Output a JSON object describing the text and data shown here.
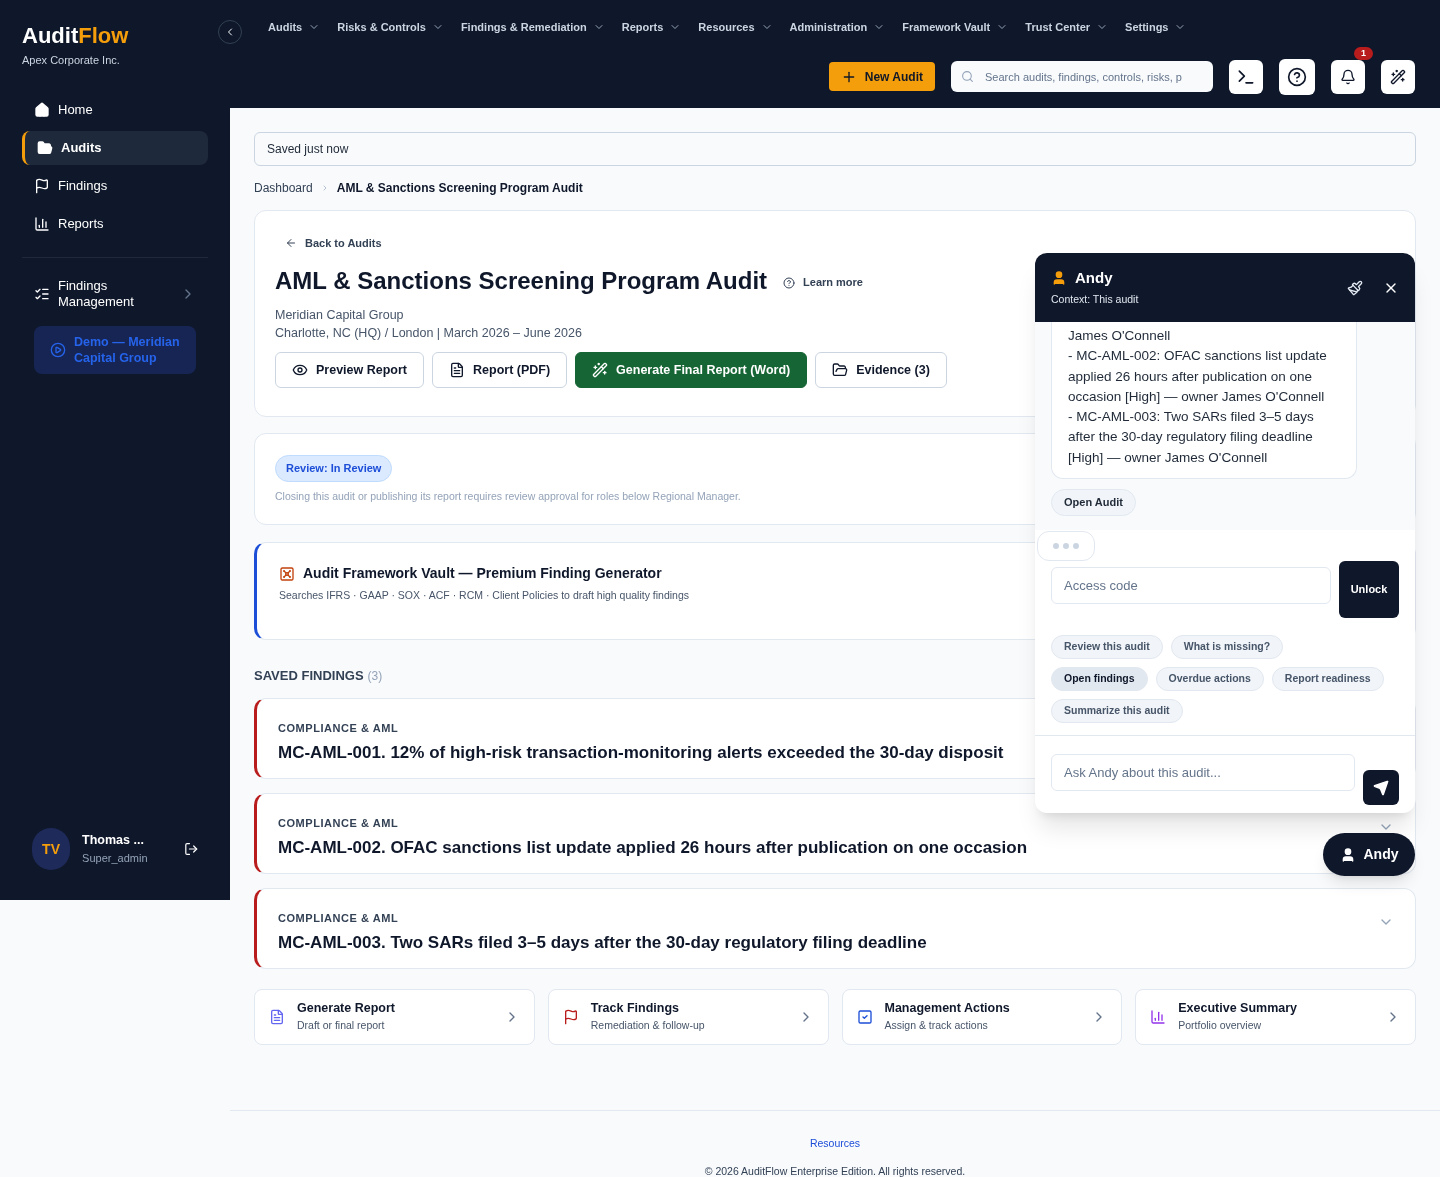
{
  "brand": {
    "name_first": "Audit",
    "name_second": "Flow",
    "company": "Apex Corporate Inc."
  },
  "sidebar": {
    "items": [
      {
        "label": "Home",
        "selected": false
      },
      {
        "label": "Audits",
        "selected": true
      },
      {
        "label": "Findings",
        "selected": false
      },
      {
        "label": "Reports",
        "selected": false
      }
    ],
    "group": {
      "label": "Findings Management"
    },
    "demo_button": "Demo — Meridian Capital Group",
    "user": {
      "initials": "TV",
      "name": "Thomas ...",
      "role": "Super_admin"
    }
  },
  "top_nav": [
    "Audits",
    "Risks & Controls",
    "Findings & Remediation",
    "Reports",
    "Resources",
    "Administration",
    "Framework Vault",
    "Trust Center",
    "Settings"
  ],
  "toolbar": {
    "new_audit": "New Audit",
    "search": {
      "placeholder": "Search audits, findings, controls, risks, p"
    },
    "notification_count": "1"
  },
  "save_status": "Saved just now",
  "breadcrumb": [
    "Dashboard",
    "AML & Sanctions Screening Program Audit"
  ],
  "audit": {
    "back": "Back to Audits",
    "title": "AML & Sanctions Screening Program Audit",
    "learn_more": "Learn more",
    "client": "Meridian Capital Group",
    "details": "Charlotte, NC (HQ) / London | March 2026 – June 2026",
    "actions": [
      {
        "label": "Preview Report",
        "kind": "outline"
      },
      {
        "label": "Report (PDF)",
        "kind": "outline"
      },
      {
        "label": "Generate Final Report (Word)",
        "kind": "primary"
      },
      {
        "label": "Evidence (3)",
        "kind": "outline"
      }
    ]
  },
  "review": {
    "badge": "Review: In Review",
    "note": "Closing this audit or publishing its report requires review approval for roles below Regional Manager."
  },
  "vault": {
    "title": "Audit Framework Vault — Premium Finding Generator",
    "subtitle": "Searches IFRS · GAAP · SOX · ACF · RCM · Client Policies to draft high quality findings"
  },
  "saved_findings": {
    "heading": "SAVED FINDINGS",
    "count": "(3)",
    "items": [
      {
        "category": "COMPLIANCE & AML",
        "title": "MC-AML-001. 12% of high-risk transaction-monitoring alerts exceeded the 30-day disposit"
      },
      {
        "category": "COMPLIANCE & AML",
        "title": "MC-AML-002. OFAC sanctions list update applied 26 hours after publication on one occasion",
        "expand_icon": true
      },
      {
        "category": "COMPLIANCE & AML",
        "title": "MC-AML-003. Two SARs filed 3–5 days after the 30-day regulatory filing deadline",
        "expand_icon": true
      }
    ]
  },
  "quick_links": [
    {
      "title": "Generate Report",
      "subtitle": "Draft or final report"
    },
    {
      "title": "Track Findings",
      "subtitle": "Remediation & follow-up"
    },
    {
      "title": "Management Actions",
      "subtitle": "Assign & track actions"
    },
    {
      "title": "Executive Summary",
      "subtitle": "Portfolio overview"
    }
  ],
  "chat": {
    "title": "Andy",
    "context": "Context: This audit",
    "message_lines": [
      "James O'Connell",
      "- MC-AML-002: OFAC sanctions list update applied 26 hours after publication on one occasion [High] — owner James O'Connell",
      "- MC-AML-003: Two SARs filed 3–5 days after the 30-day regulatory filing deadline [High] — owner James O'Connell"
    ],
    "message_action": "Open Audit",
    "access_code": {
      "placeholder": "Access code"
    },
    "unlock": "Unlock",
    "suggestion_rows": [
      [
        {
          "label": "Review this audit",
          "selected": false
        },
        {
          "label": "What is missing?",
          "selected": false
        }
      ],
      [
        {
          "label": "Open findings",
          "selected": true
        },
        {
          "label": "Overdue actions",
          "selected": false
        },
        {
          "label": "Report readiness",
          "selected": false
        }
      ],
      [
        {
          "label": "Summarize this audit",
          "selected": false
        }
      ]
    ],
    "ask": {
      "placeholder": "Ask Andy about this audit..."
    },
    "launcher": "Andy"
  },
  "footer": {
    "link": "Resources",
    "copyright": "© 2026 AuditFlow Enterprise Edition. All rights reserved."
  }
}
